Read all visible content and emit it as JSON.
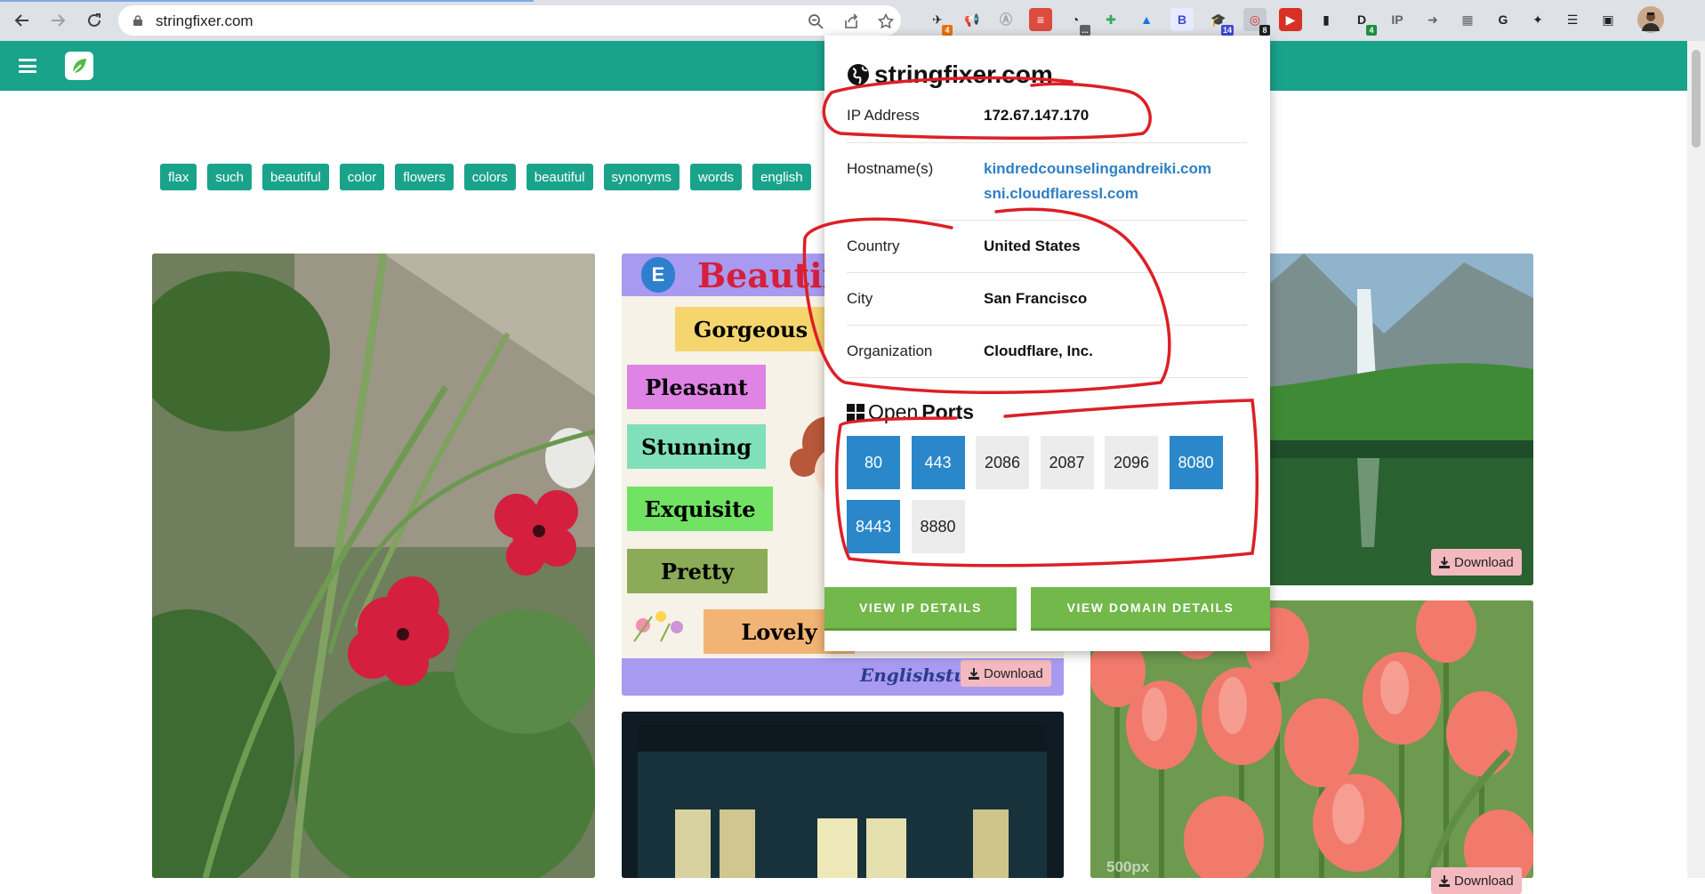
{
  "browser": {
    "url": "stringfixer.com",
    "extensions": [
      {
        "icon": "extension-bird-icon",
        "badge": "4",
        "badge_color": "#e8710a"
      },
      {
        "icon": "megaphone-icon",
        "badge": "",
        "badge_color": ""
      },
      {
        "icon": "acrobat-icon",
        "badge": "",
        "badge_color": ""
      },
      {
        "icon": "todoist-icon",
        "badge": "",
        "badge_color": ""
      },
      {
        "icon": "speedometer-icon",
        "badge": "...",
        "badge_color": "#5f6368"
      },
      {
        "icon": "plus-extension-icon",
        "badge": "",
        "badge_color": ""
      },
      {
        "icon": "google-drive-icon",
        "badge": "",
        "badge_color": ""
      },
      {
        "icon": "bootstrap-icon",
        "badge": "",
        "badge_color": ""
      },
      {
        "icon": "graduation-cap-icon",
        "badge": "14",
        "badge_color": "#3c4bd1"
      },
      {
        "icon": "ip-tracker-icon",
        "badge": "8",
        "badge_color": "#202124"
      },
      {
        "icon": "shield-red-icon",
        "badge": "",
        "badge_color": ""
      },
      {
        "icon": "reader-icon",
        "badge": "",
        "badge_color": ""
      },
      {
        "icon": "d-extension-icon",
        "badge": "4",
        "badge_color": "#1e8e3e"
      },
      {
        "icon": "ip-text-icon",
        "badge": "",
        "badge_color": ""
      },
      {
        "icon": "arrow-extension-icon",
        "badge": "",
        "badge_color": ""
      },
      {
        "icon": "grid-extension-icon",
        "badge": "",
        "badge_color": ""
      },
      {
        "icon": "grammarly-icon",
        "badge": "",
        "badge_color": ""
      },
      {
        "icon": "puzzle-icon",
        "badge": "",
        "badge_color": ""
      },
      {
        "icon": "media-queue-icon",
        "badge": "",
        "badge_color": ""
      },
      {
        "icon": "sidepanel-icon",
        "badge": "",
        "badge_color": ""
      }
    ]
  },
  "site": {
    "tags": [
      "flax",
      "such",
      "beautiful",
      "color",
      "flowers",
      "colors",
      "beautiful",
      "synonyms",
      "words",
      "english"
    ],
    "download_label": "Download",
    "vocab_title": "Beautif",
    "vocab_words": [
      "Gorgeous",
      "Pleasant",
      "Stunning",
      "Exquisite",
      "Pretty",
      "Lovely"
    ],
    "vocab_brand": "Englishstu",
    "watermark": "500px"
  },
  "popup": {
    "title": "stringfixer.com",
    "rows": {
      "ip_label": "IP Address",
      "ip_value": "172.67.147.170",
      "host_label": "Hostname(s)",
      "host_value_1": "kindredcounselingandreiki.com",
      "host_value_2": "sni.cloudflaressl.com",
      "country_label": "Country",
      "country_value": "United States",
      "city_label": "City",
      "city_value": "San Francisco",
      "org_label": "Organization",
      "org_value": "Cloudflare, Inc."
    },
    "ports_title_light": "Open ",
    "ports_title_bold": "Ports",
    "ports": [
      {
        "port": "80",
        "open": true
      },
      {
        "port": "443",
        "open": true
      },
      {
        "port": "2086",
        "open": false
      },
      {
        "port": "2087",
        "open": false
      },
      {
        "port": "2096",
        "open": false
      },
      {
        "port": "8080",
        "open": true
      },
      {
        "port": "8443",
        "open": true
      },
      {
        "port": "8880",
        "open": false
      }
    ],
    "btn_ip": "VIEW IP DETAILS",
    "btn_domain": "VIEW DOMAIN DETAILS"
  },
  "colors": {
    "accent": "#1aa38b",
    "open_port": "#2a87c9",
    "button_green": "#72b84b",
    "annotation": "#dd1f26"
  }
}
